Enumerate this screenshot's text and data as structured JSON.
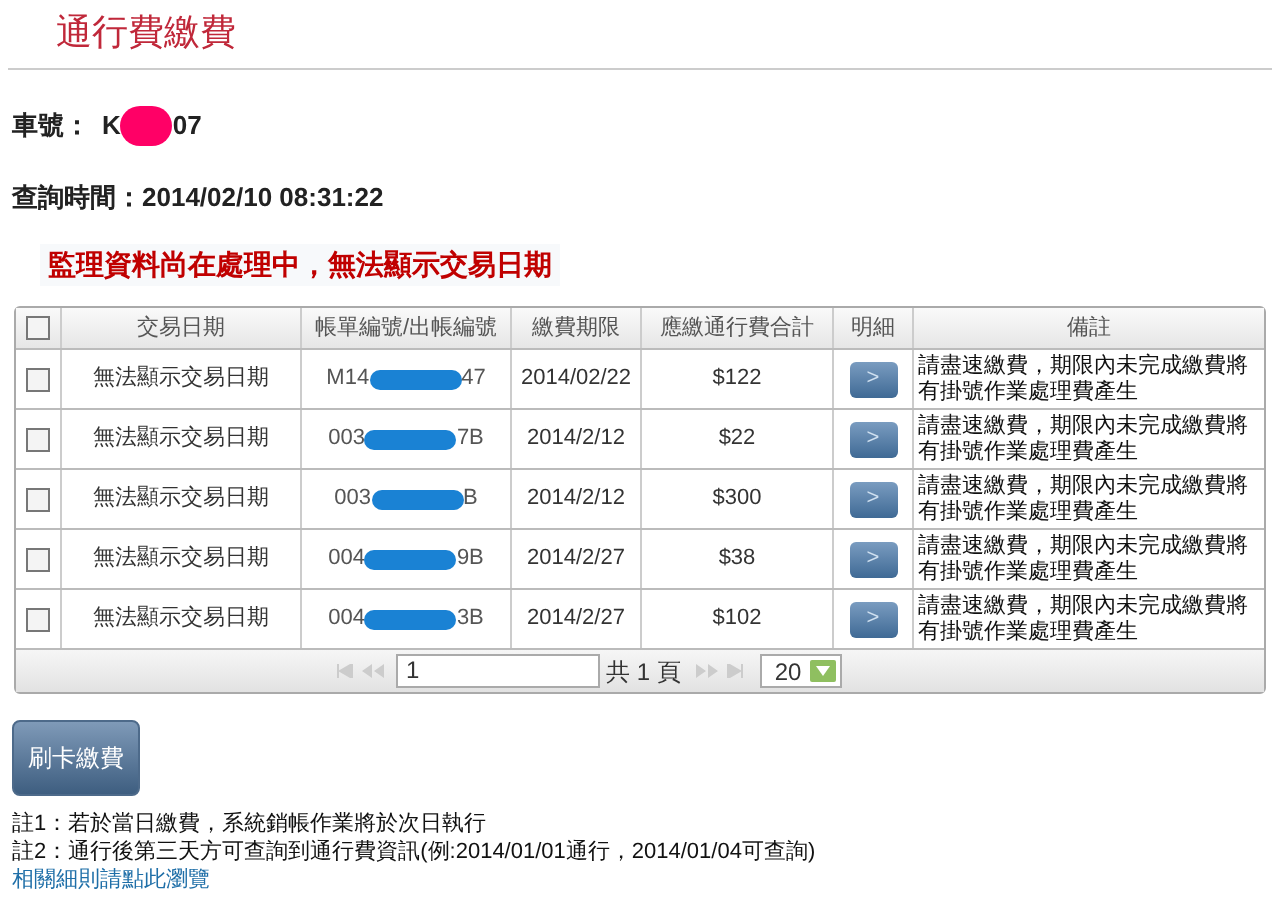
{
  "title": "通行費繳費",
  "plate": {
    "label": "車號：",
    "start": "K",
    "end": "07"
  },
  "query_time": {
    "label": "查詢時間：",
    "value": "2014/02/10 08:31:22"
  },
  "warning": "監理資料尚在處理中，無法顯示交易日期",
  "table": {
    "select_all": {
      "checked": false
    },
    "columns": [
      "交易日期",
      "帳單編號/出帳編號",
      "繳費期限",
      "應繳通行費合計",
      "明細",
      "備註"
    ],
    "rows": [
      {
        "checked": false,
        "date": "無法顯示交易日期",
        "bill_start": "M14",
        "bill_end": "47",
        "due": "2014/02/22",
        "amount": "$122",
        "detail": ">",
        "note": "請盡速繳費，期限內未完成繳費將有掛號作業處理費產生"
      },
      {
        "checked": false,
        "date": "無法顯示交易日期",
        "bill_start": "003",
        "bill_end": "7B",
        "due": "2014/2/12",
        "amount": "$22",
        "detail": ">",
        "note": "請盡速繳費，期限內未完成繳費將有掛號作業處理費產生"
      },
      {
        "checked": false,
        "date": "無法顯示交易日期",
        "bill_start": "003",
        "bill_end": "B",
        "due": "2014/2/12",
        "amount": "$300",
        "detail": ">",
        "note": "請盡速繳費，期限內未完成繳費將有掛號作業處理費產生"
      },
      {
        "checked": false,
        "date": "無法顯示交易日期",
        "bill_start": "004",
        "bill_end": "9B",
        "due": "2014/2/27",
        "amount": "$38",
        "detail": ">",
        "note": "請盡速繳費，期限內未完成繳費將有掛號作業處理費產生"
      },
      {
        "checked": false,
        "date": "無法顯示交易日期",
        "bill_start": "004",
        "bill_end": "3B",
        "due": "2014/2/27",
        "amount": "$102",
        "detail": ">",
        "note": "請盡速繳費，期限內未完成繳費將有掛號作業處理費產生"
      }
    ],
    "pager": {
      "page": "1",
      "total": "共 1 頁",
      "page_size": "20"
    }
  },
  "pay_button": "刷卡繳費",
  "notes": [
    "註1：若於當日繳費，系統銷帳作業將於次日執行",
    "註2：通行後第三天方可查詢到通行費資訊(例:2014/01/01通行，2014/01/04可查詢)"
  ],
  "link": "相關細則請點此瀏覽"
}
